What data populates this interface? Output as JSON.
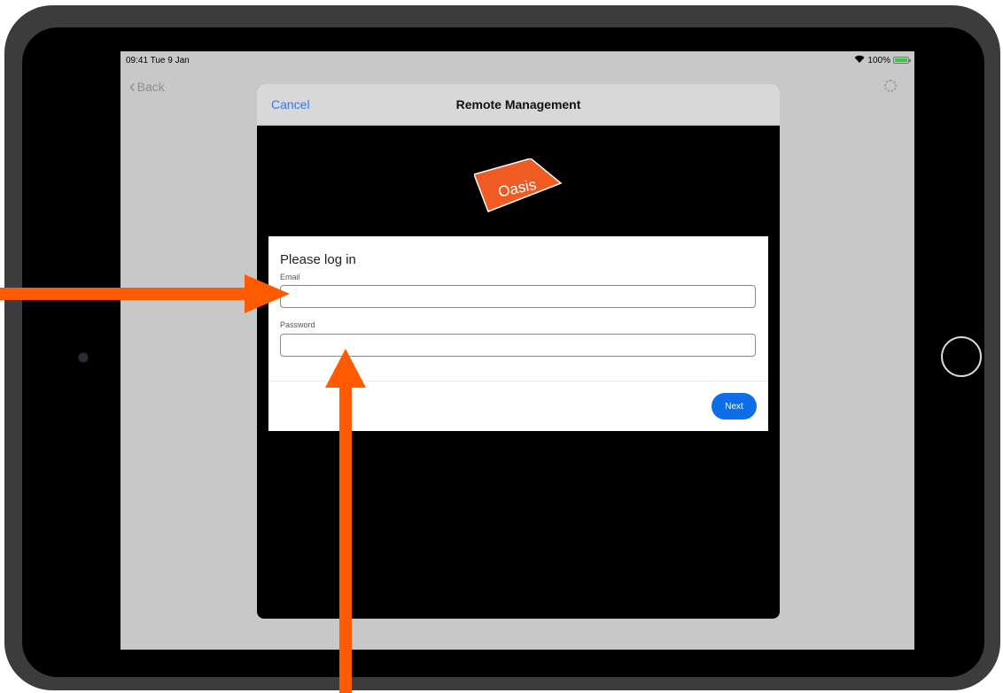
{
  "status_bar": {
    "time": "09:41  Tue 9 Jan",
    "battery": "100%"
  },
  "nav": {
    "back_label": "Back"
  },
  "modal": {
    "cancel_label": "Cancel",
    "title": "Remote Management",
    "logo_text": "Oasis"
  },
  "login": {
    "heading": "Please log in",
    "email_label": "Email",
    "email_value": "",
    "password_label": "Password",
    "password_value": "",
    "next_label": "Next"
  },
  "colors": {
    "accent": "#0e6ee8",
    "link": "#3478f6",
    "annotation_arrow": "#ff5a00",
    "logo": "#f05a23"
  },
  "icons": {
    "wifi": "wifi-icon",
    "battery": "battery-icon",
    "back": "chevron-left-icon",
    "spinner": "spinner-icon"
  }
}
